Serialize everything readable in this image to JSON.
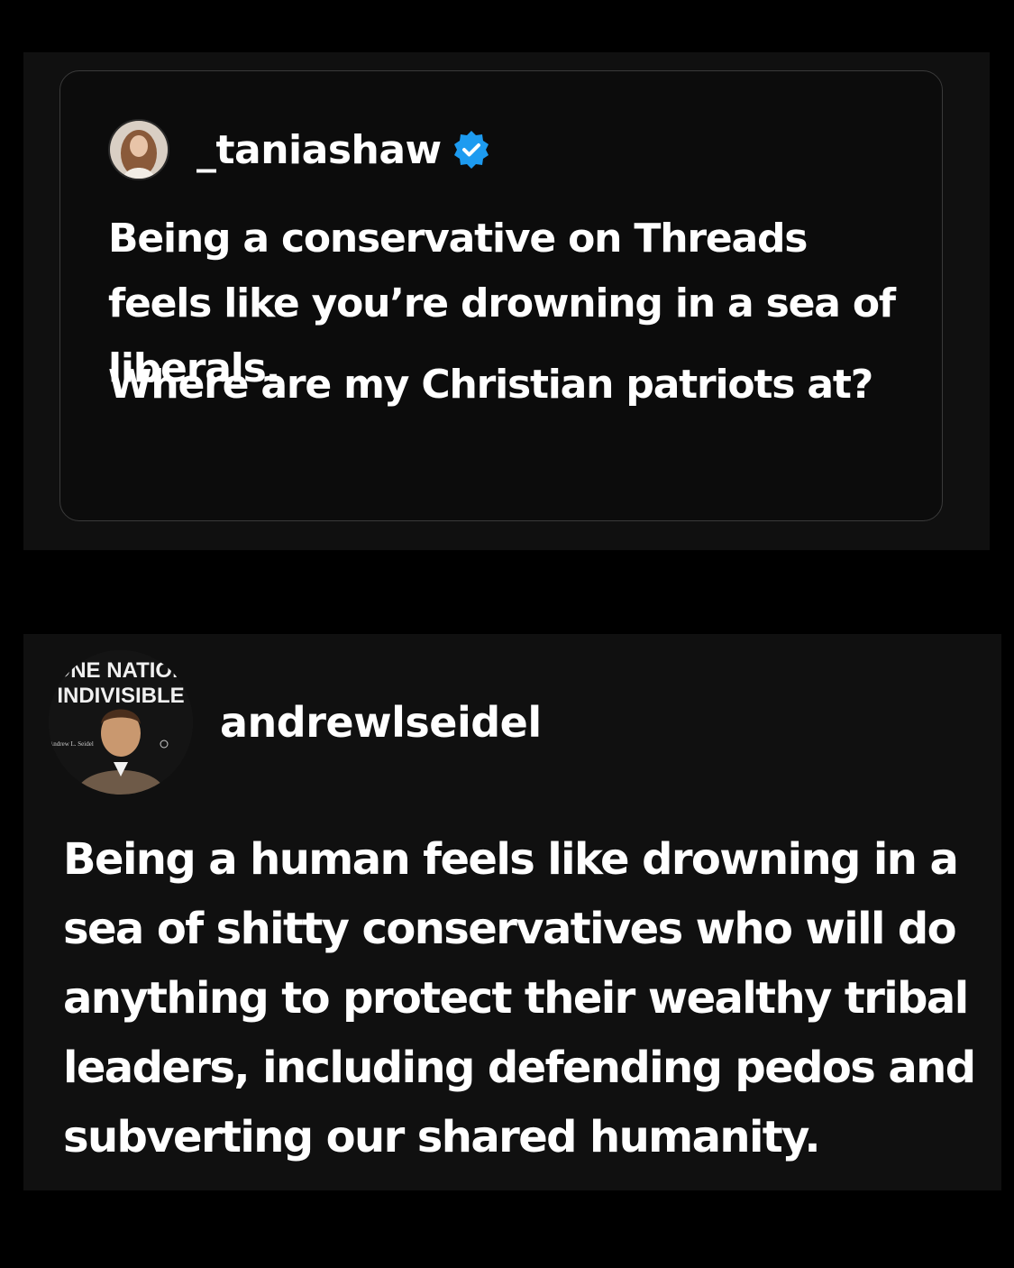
{
  "quoted_post": {
    "username": "_taniashaw",
    "verified": true,
    "verified_color": "#1d9bf0",
    "paragraph_1": "Being a conservative on Threads feels like you’re drowning in a sea of liberals.",
    "paragraph_2": "Where are my Christian patriots at?"
  },
  "reply_post": {
    "username": "andrewlseidel",
    "avatar_lettering": [
      "ONE NATION",
      "INDIVISIBLE",
      "Andrew L. Seidel"
    ],
    "text": "Being a human feels like drowning in a sea of shitty conservatives who will do anything to protect their wealthy tribal leaders, including defending pedos and subverting our shared humanity."
  },
  "colors": {
    "background": "#000000",
    "panel": "#101010",
    "card_border": "#3a3a3a",
    "text": "#ffffff"
  }
}
